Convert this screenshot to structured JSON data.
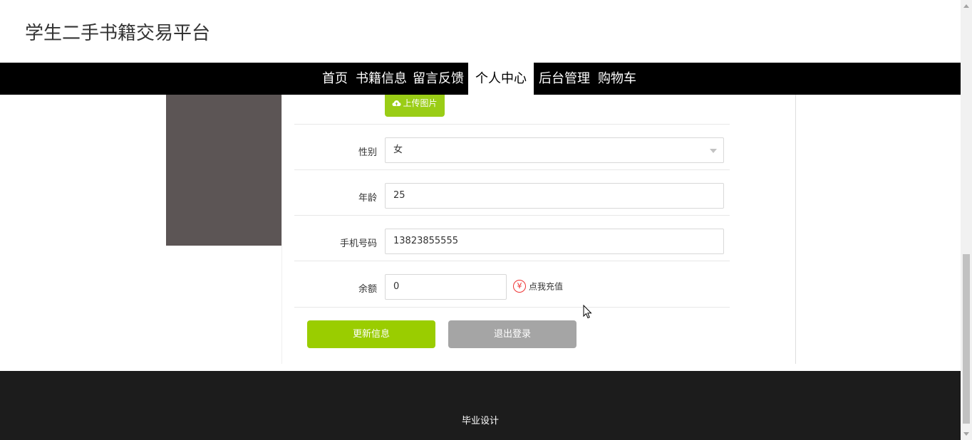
{
  "header": {
    "site_title": "学生二手书籍交易平台"
  },
  "nav": {
    "items": [
      {
        "label": "首页"
      },
      {
        "label": "书籍信息"
      },
      {
        "label": "留言反馈"
      },
      {
        "label": "个人中心"
      },
      {
        "label": "后台管理"
      },
      {
        "label": "购物车"
      }
    ],
    "active": "个人中心"
  },
  "form": {
    "upload_label": "上传图片",
    "gender": {
      "label": "性别",
      "value": "女"
    },
    "age": {
      "label": "年龄",
      "value": "25"
    },
    "phone": {
      "label": "手机号码",
      "value": "13823855555"
    },
    "balance": {
      "label": "余额",
      "value": "0"
    },
    "recharge_label": "点我充值",
    "recharge_icon": "yen-icon",
    "update_label": "更新信息",
    "logout_label": "退出登录"
  },
  "footer": {
    "text": "毕业设计"
  },
  "colors": {
    "accent_green": "#9acd00",
    "nav_bg": "#000000",
    "footer_bg": "#1c1c1c",
    "logout_gray": "#a5a5a5",
    "yen_red": "#ee3333"
  }
}
